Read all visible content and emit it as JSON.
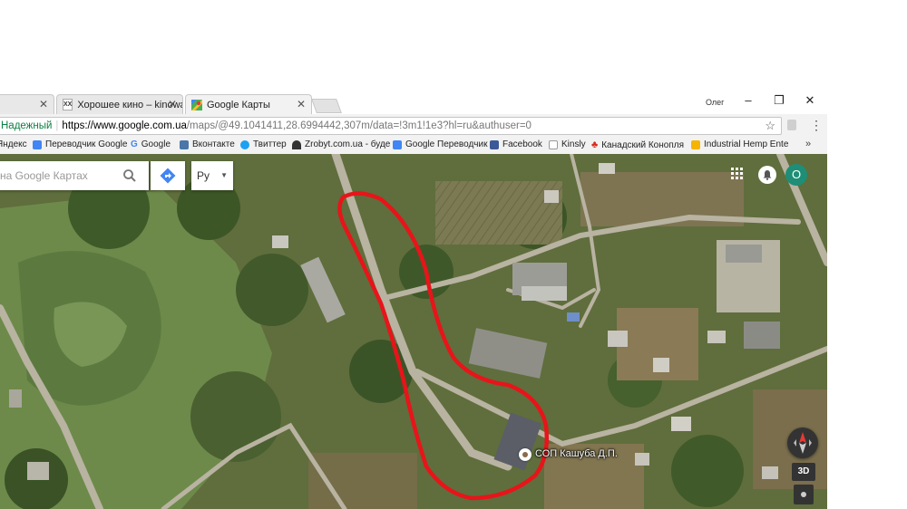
{
  "tabs": [
    {
      "label": "",
      "active": false
    },
    {
      "label": "Хорошее кино – kinowa",
      "favicon": "XX",
      "active": false
    },
    {
      "label": "Google Карты",
      "favicon": "maps-icon",
      "active": true
    }
  ],
  "window": {
    "user": "Олег",
    "minimize": "–",
    "restore": "❐",
    "close": "✕"
  },
  "address_bar": {
    "security": "Надежный",
    "url_host": "https://www.google.com.ua",
    "url_path": "/maps/@49.1041411,28.6994442,307m/data=!3m1!1e3?hl=ru&authuser=0",
    "bookmark_star": "☆"
  },
  "bookmarks": [
    {
      "label": "Яндекс",
      "icon": "none"
    },
    {
      "label": "Переводчик Google",
      "icon": "translate-icon"
    },
    {
      "label": "Google",
      "icon": "google-icon"
    },
    {
      "label": "Вконтакте",
      "icon": "vk-icon"
    },
    {
      "label": "Твиттер",
      "icon": "twitter-icon"
    },
    {
      "label": "Zrobyt.com.ua - буде",
      "icon": "zrobyt-icon"
    },
    {
      "label": "Google Переводчик",
      "icon": "translate-icon"
    },
    {
      "label": "Facebook",
      "icon": "facebook-icon"
    },
    {
      "label": "Kinsly",
      "icon": "page-icon"
    },
    {
      "label": "Канадский Конопля",
      "icon": "maple-leaf-icon"
    },
    {
      "label": "Industrial Hemp Ente",
      "icon": "folder-icon"
    }
  ],
  "bookmarks_more": "»",
  "map": {
    "search_placeholder": "на Google Картах",
    "language": "Ру",
    "avatar_letter": "О",
    "place_label": "СОП Кашуба Д.П.",
    "btn_3d": "3D",
    "view": "satellite",
    "colors": {
      "route": "#e8141a",
      "avatar": "#1e8e76",
      "directions": "#4285f4"
    }
  }
}
